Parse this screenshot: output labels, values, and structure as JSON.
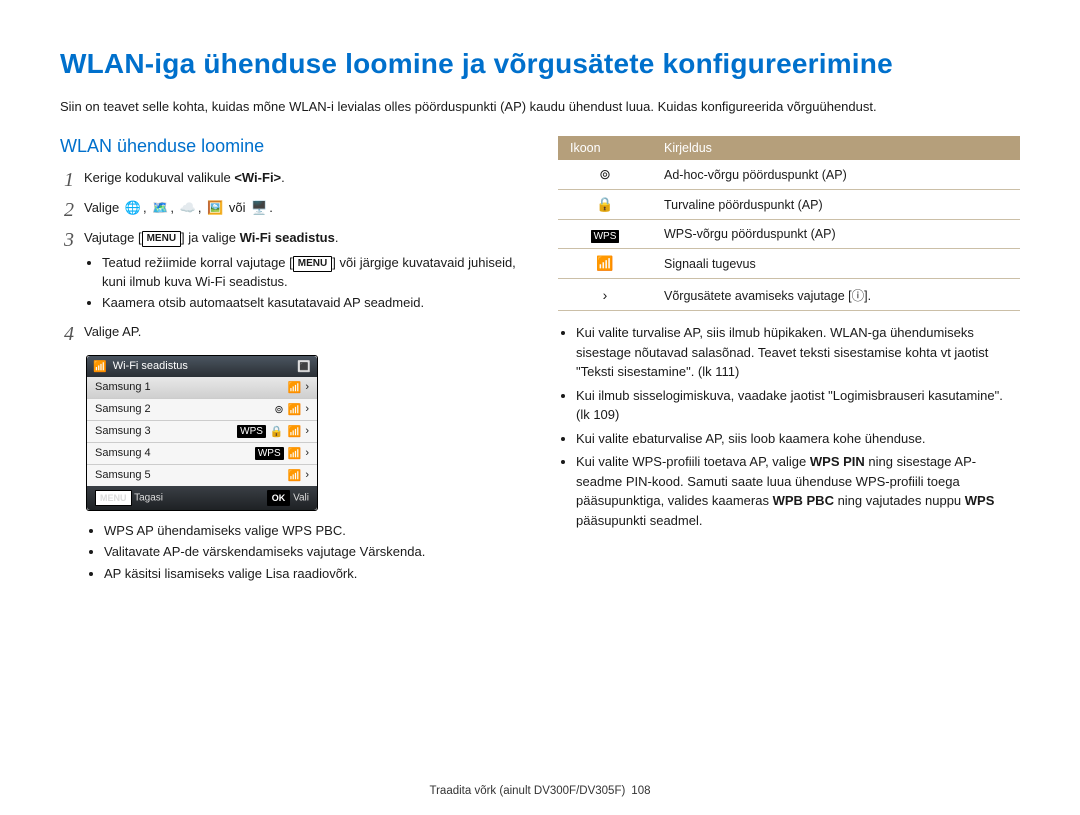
{
  "title": "WLAN-iga ühenduse loomine ja võrgusätete konfigureerimine",
  "intro": "Siin on teavet selle kohta, kuidas mõne WLAN-i levialas olles pöörduspunkti (AP) kaudu ühendust luua. Kuidas konfigureerida võrguühendust.",
  "section": "WLAN ühenduse loomine",
  "steps": {
    "n1": "1",
    "s1_pre": "Kerige kodukuval valikule ",
    "s1_wifi": "<Wi-Fi>",
    "s1_post": ".",
    "n2": "2",
    "s2_word": "Valige ",
    "s2_or": " või ",
    "s2_end": ".",
    "n3": "3",
    "s3_pre": "Vajutage ",
    "s3_menu": "MENU",
    "s3_mid": " ja valige ",
    "s3_wifi": "Wi-Fi seadistus",
    "s3_end": ".",
    "s3_b1_pre": "Teatud režiimide korral vajutage ",
    "s3_b1_menu": "MENU",
    "s3_b1_post": " või järgige kuvatavaid juhiseid, kuni ilmub kuva Wi-Fi seadistus.",
    "s3_b2": "Kaamera otsib automaatselt kasutatavaid AP seadmeid.",
    "n4": "4",
    "s4": "Valige AP."
  },
  "ap": {
    "title": "Wi-Fi seadistus",
    "rows": [
      {
        "name": "Samsung 1",
        "adhoc": false,
        "wps": false,
        "lock": false
      },
      {
        "name": "Samsung 2",
        "adhoc": true,
        "wps": false,
        "lock": false
      },
      {
        "name": "Samsung 3",
        "adhoc": false,
        "wps": true,
        "lock": true
      },
      {
        "name": "Samsung 4",
        "adhoc": false,
        "wps": true,
        "lock": false
      },
      {
        "name": "Samsung 5",
        "adhoc": false,
        "wps": false,
        "lock": false
      }
    ],
    "back_key": "MENU",
    "back": "Tagasi",
    "ok_key": "OK",
    "ok": "Vali"
  },
  "post": {
    "b1_pre": "WPS AP ühendamiseks valige ",
    "b1_b": "WPS PBC",
    "b1_post": ".",
    "b2_pre": "Valitavate AP-de värskendamiseks vajutage ",
    "b2_b": "Värskenda",
    "b2_post": ".",
    "b3_pre": "AP käsitsi lisamiseks valige ",
    "b3_b": "Lisa raadiovõrk",
    "b3_post": "."
  },
  "table": {
    "h1": "Ikoon",
    "h2": "Kirjeldus",
    "r1": "Ad-hoc-võrgu pöörduspunkt (AP)",
    "r2": "Turvaline pöörduspunkt (AP)",
    "r3": "WPS-võrgu pöörduspunkt (AP)",
    "r4": "Signaali tugevus",
    "r5_pre": "Võrgusätete avamiseks vajutage [",
    "r5_mid": "",
    "r5_post": "]."
  },
  "right": {
    "b1": "Kui valite turvalise AP, siis ilmub hüpikaken. WLAN-ga ühendumiseks sisestage nõutavad salasõnad. Teavet teksti sisestamise kohta vt jaotist \"Teksti sisestamine\". (lk 111)",
    "b2": "Kui ilmub sisselogimiskuva, vaadake jaotist \"Logimisbrauseri kasutamine\". (lk 109)",
    "b3": "Kui valite ebaturvalise AP, siis loob kaamera kohe ühenduse.",
    "b4_pre": "Kui valite WPS-profiili toetava AP, valige ",
    "b4_b1": "WPS PIN",
    "b4_mid": " ning sisestage AP-seadme PIN-kood. Samuti saate luua ühenduse WPS-profiili toega pääsupunktiga, valides kaameras ",
    "b4_b2": "WPB PBC",
    "b4_mid2": " ning vajutades nuppu ",
    "b4_b3": "WPS",
    "b4_post": " pääsupunkti seadmel."
  },
  "footer": {
    "text": "Traadita võrk (ainult DV300F/DV305F)",
    "page": "108"
  },
  "icons": {
    "globe": "🌐",
    "map": "🗺️",
    "cloud": "☁️",
    "pic": "🖼️",
    "monitor": "🖥️",
    "adhoc": "⊚",
    "lock": "🔒",
    "wps": "WPS",
    "sig": "📶",
    "arrow": "›",
    "timer": "ⓘ",
    "wifi": "📶",
    "batt": "🔳"
  }
}
